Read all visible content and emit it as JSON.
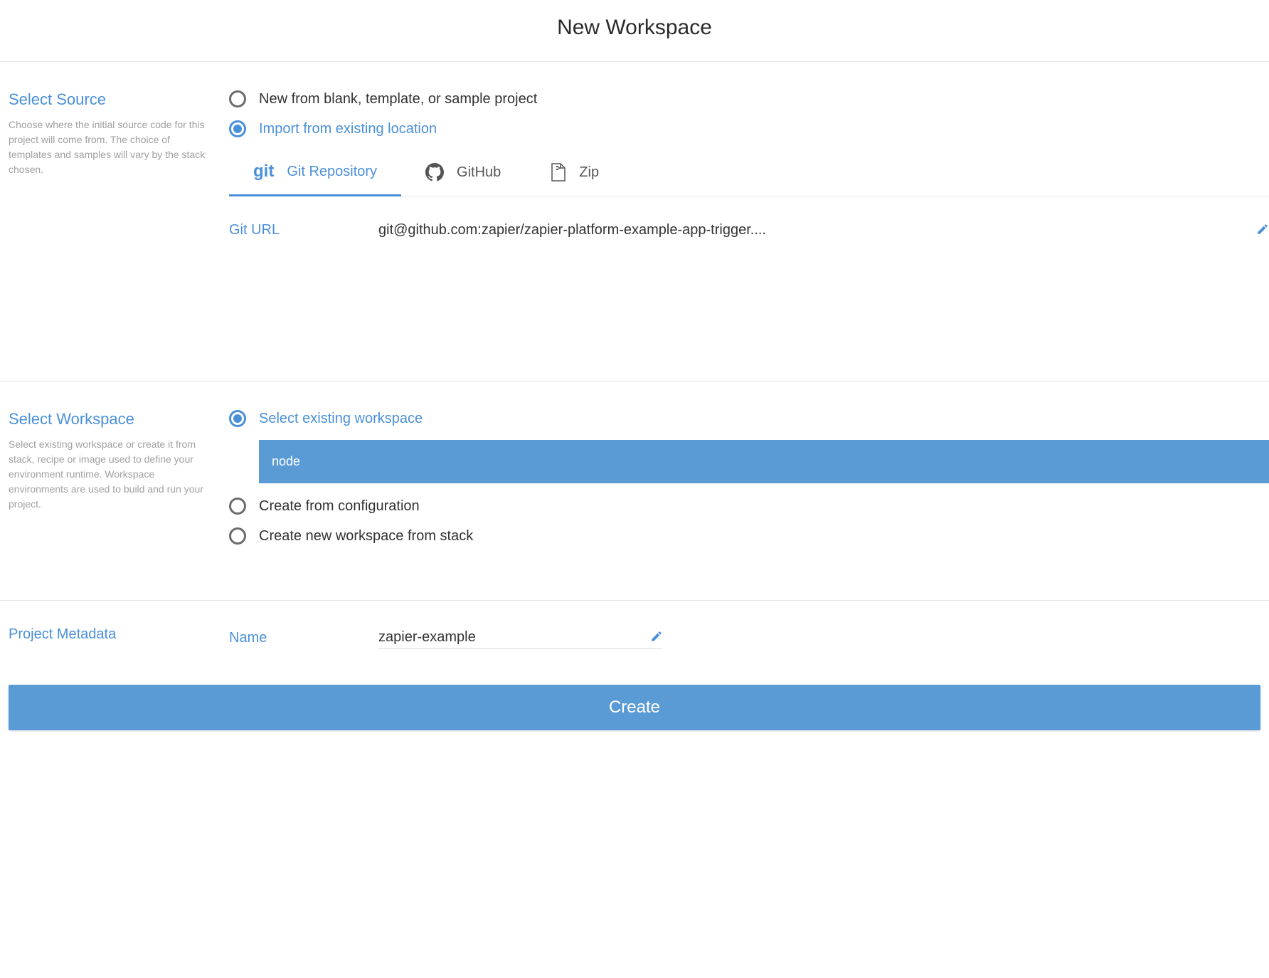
{
  "page_title": "New Workspace",
  "source": {
    "title": "Select Source",
    "description": "Choose where the initial source code for this project will come from. The choice of templates and samples will vary by the stack chosen.",
    "options": {
      "new_blank": "New from blank, template, or sample project",
      "import_existing": "Import from existing location"
    },
    "tabs": {
      "git_repo": "Git Repository",
      "github": "GitHub",
      "zip": "Zip"
    },
    "git_url_label": "Git URL",
    "git_url_value": "git@github.com:zapier/zapier-platform-example-app-trigger...."
  },
  "workspace": {
    "title": "Select Workspace",
    "description": "Select existing workspace or create it from stack, recipe or image used to define your environment runtime. Workspace environments are used to build and run your project.",
    "options": {
      "select_existing": "Select existing workspace",
      "from_config": "Create from configuration",
      "from_stack": "Create new workspace from stack"
    },
    "existing_workspace_name": "node"
  },
  "metadata": {
    "title": "Project Metadata",
    "name_label": "Name",
    "name_value": "zapier-example"
  },
  "create_button_label": "Create"
}
